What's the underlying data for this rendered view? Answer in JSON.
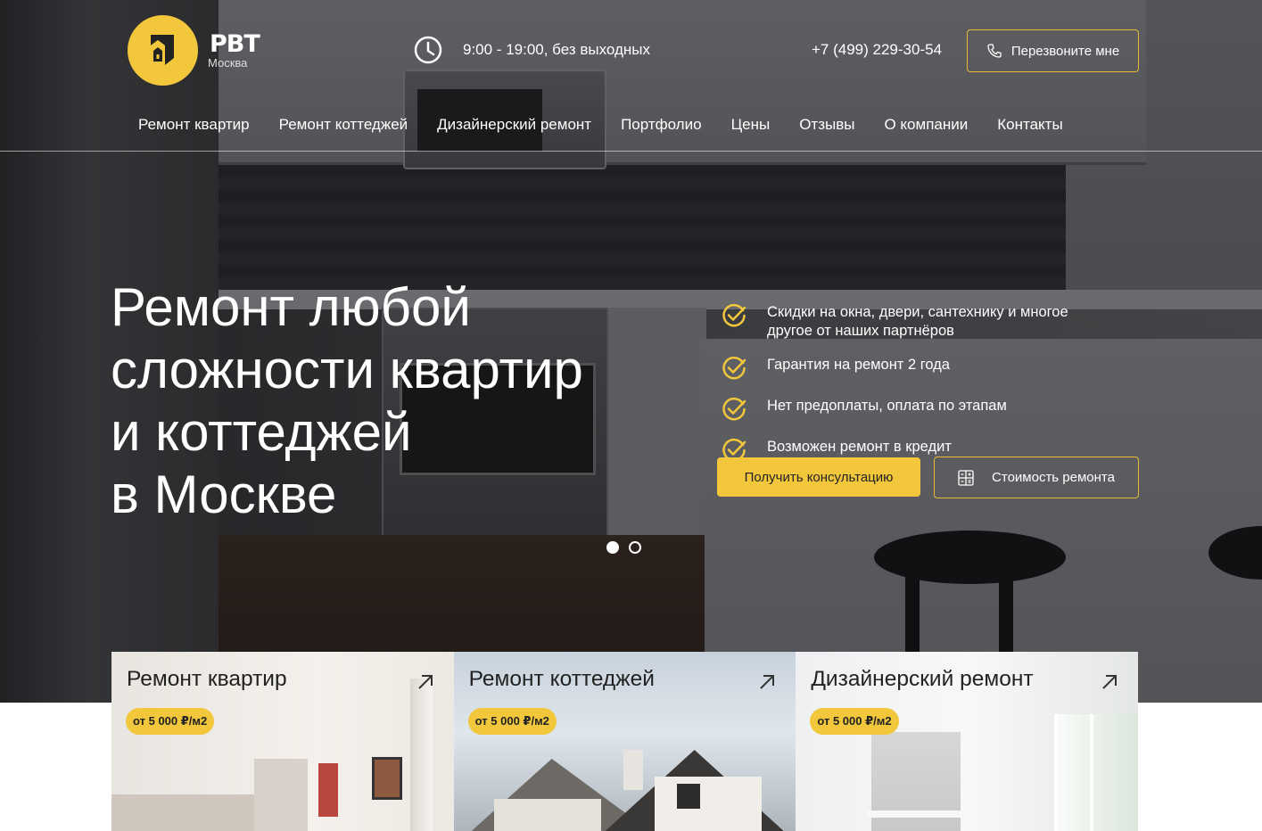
{
  "brand": {
    "name": "РВТ",
    "city": "Москва"
  },
  "header": {
    "hours": "9:00 - 19:00, без выходных",
    "phone": "+7 (499) 229-30-54",
    "callback_label": "Перезвоните мне"
  },
  "nav": [
    "Ремонт квартир",
    "Ремонт коттеджей",
    "Дизайнерский ремонт",
    "Портфолио",
    "Цены",
    "Отзывы",
    "О компании",
    "Контакты"
  ],
  "hero": {
    "title_lines": [
      "Ремонт любой",
      "сложности квартир",
      "и коттеджей",
      "в Москве"
    ],
    "benefits": [
      "Скидки на окна, двери, сантехнику и многое другое от наших партнёров",
      "Гарантия на ремонт 2 года",
      "Нет предоплаты, оплата по этапам",
      "Возможен ремонт в кредит"
    ],
    "consult_label": "Получить консультацию",
    "cost_label": "Стоимость ремонта",
    "slides": {
      "count": 2,
      "active": 1
    }
  },
  "cards": [
    {
      "title": "Ремонт квартир",
      "price": "от 5 000 ₽/м2"
    },
    {
      "title": "Ремонт коттеджей",
      "price": "от 5 000 ₽/м2"
    },
    {
      "title": "Дизайнерский ремонт",
      "price": "от 5 000 ₽/м2"
    }
  ],
  "colors": {
    "accent": "#f2c73c",
    "text_light": "#ffffff",
    "text_dark": "#222222"
  },
  "icons": [
    "house-logo-icon",
    "clock-icon",
    "phone-icon",
    "check-circle-icon",
    "calculator-icon",
    "arrow-up-right-icon"
  ]
}
